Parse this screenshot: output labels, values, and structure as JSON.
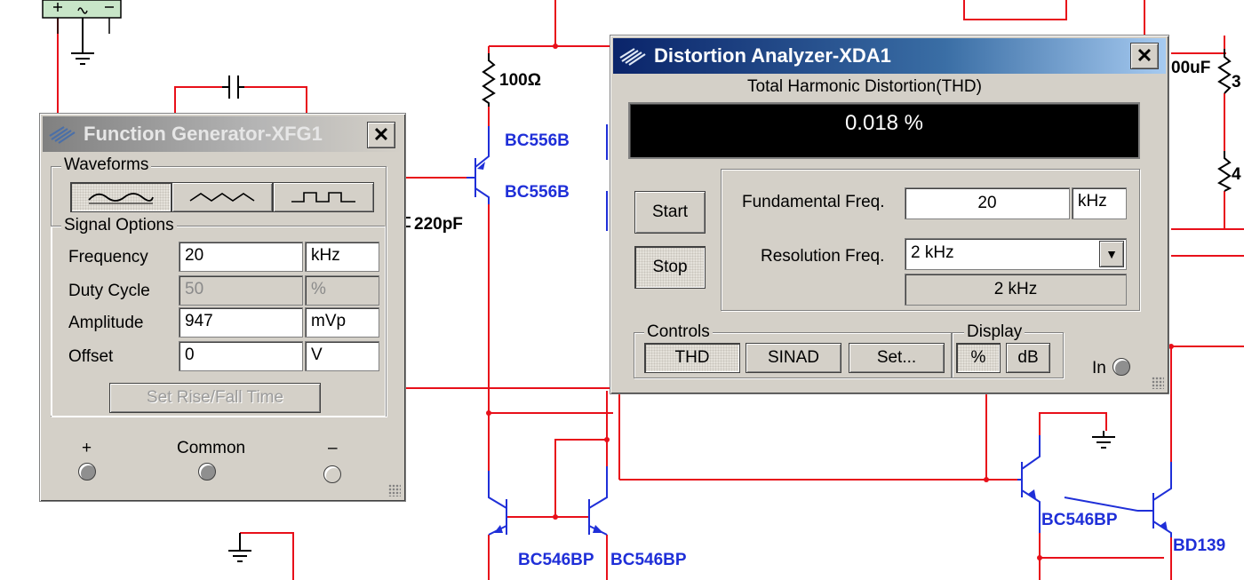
{
  "schematic": {
    "colors": {
      "wire": "#e8101a",
      "component": "#1f2fd8",
      "ground": "#000000"
    },
    "labels": {
      "r100": "100Ω",
      "q1": "BC556B",
      "q2": "BC556B",
      "c220": "220pF",
      "q3": "BC546BP",
      "q4": "BC546BP",
      "q5": "BC546BP",
      "q6": "BD139",
      "cap_partial": "00uF",
      "res_partial_1": "3",
      "res_partial_2": "4"
    }
  },
  "function_generator": {
    "title": "Function Generator-XFG1",
    "close": "✕",
    "waveforms_label": "Waveforms",
    "waveforms": [
      {
        "name": "sine",
        "selected": true
      },
      {
        "name": "triangle",
        "selected": false
      },
      {
        "name": "square",
        "selected": false
      }
    ],
    "signal_options_label": "Signal Options",
    "frequency": {
      "label": "Frequency",
      "value": "20",
      "unit": "kHz"
    },
    "duty_cycle": {
      "label": "Duty Cycle",
      "value": "50",
      "unit": "%"
    },
    "amplitude": {
      "label": "Amplitude",
      "value": "947",
      "unit": "mVp"
    },
    "offset": {
      "label": "Offset",
      "value": "0",
      "unit": "V"
    },
    "rise_fall_button": "Set Rise/Fall Time",
    "terminals": {
      "plus": "+",
      "common": "Common",
      "minus": "–"
    }
  },
  "distortion_analyzer": {
    "title": "Distortion Analyzer-XDA1",
    "close": "✕",
    "thd_label": "Total Harmonic Distortion(THD)",
    "thd_value": "0.018 %",
    "start": "Start",
    "stop": "Stop",
    "fundamental_label": "Fundamental Freq.",
    "fundamental_value": "20",
    "fundamental_unit": "kHz",
    "resolution_label": "Resolution Freq.",
    "resolution_value": "2 kHz",
    "resolution_readout": "2 kHz",
    "controls_label": "Controls",
    "thd_button": "THD",
    "sinad_button": "SINAD",
    "set_button": "Set...",
    "display_label": "Display",
    "percent_button": "%",
    "db_button": "dB",
    "in_label": "In"
  }
}
